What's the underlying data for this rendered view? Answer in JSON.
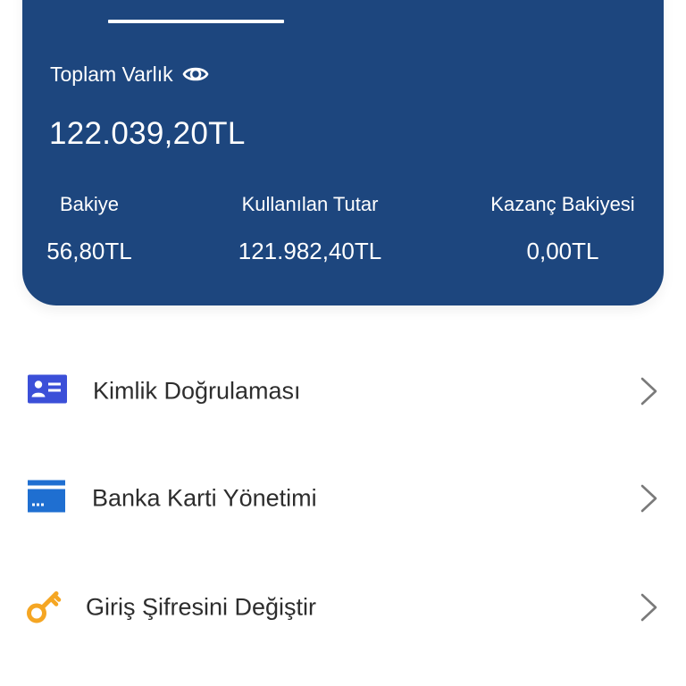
{
  "colors": {
    "card_background": "#1d467e",
    "id_icon": "#3b4fd8",
    "bank_icon": "#1f6fd1",
    "key_icon": "#f5a623",
    "chevron": "#7a7a7a",
    "menu_text": "#2d2d2d"
  },
  "summary": {
    "total_label": "Toplam Varlık",
    "total_icon": "eye-icon",
    "total_value": "122.039,20TL",
    "stats": [
      {
        "label": "Bakiye",
        "value": "56,80TL"
      },
      {
        "label": "Kullanılan Tutar",
        "value": "121.982,40TL"
      },
      {
        "label": "Kazanç Bakiyesi",
        "value": "0,00TL"
      }
    ]
  },
  "menu": {
    "items": [
      {
        "label": "Kimlik Doğrulaması",
        "icon": "id-card-icon"
      },
      {
        "label": "Banka Karti Yönetimi",
        "icon": "bank-card-icon"
      },
      {
        "label": "Giriş Şifresini Değiştir",
        "icon": "key-icon"
      }
    ]
  }
}
